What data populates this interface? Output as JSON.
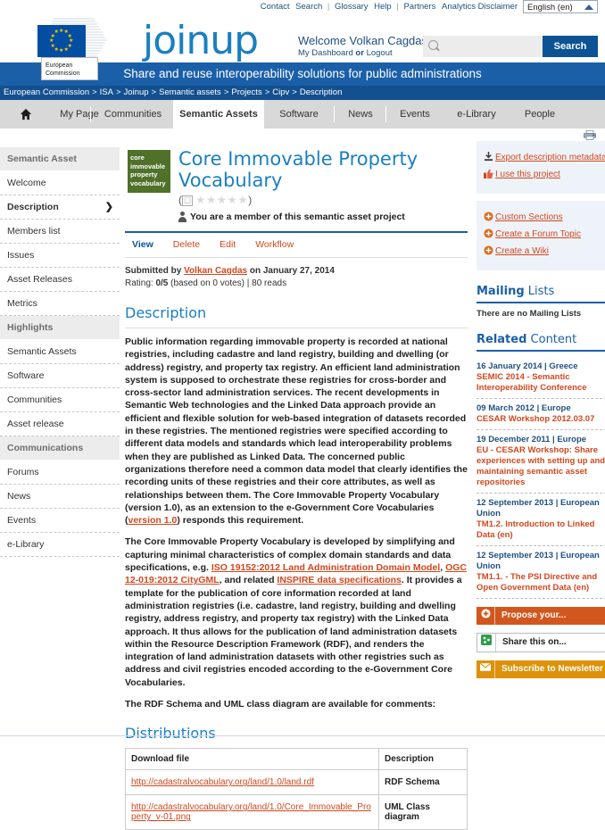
{
  "top_utility": {
    "links": [
      "Contact",
      "Search",
      "Glossary",
      "Help",
      "Partners",
      "Analytics Disclaimer"
    ],
    "language": "English (en)",
    "caret_icon": "caret-up-icon"
  },
  "header": {
    "ec_label": "European Commission",
    "site_logo": "joinup",
    "welcome": "Welcome Volkan Cagdas",
    "my_dashboard": "My Dashboard",
    "or": "or",
    "logout": "Logout",
    "search_placeholder": "",
    "search_value": "",
    "search_button": "Search",
    "search_icon": "search-icon"
  },
  "banner": {
    "ec_tag": "European Commission",
    "tagline": "Share and reuse interoperability solutions for public administrations"
  },
  "breadcrumb": [
    "European Commission",
    "ISA",
    "Joinup",
    "Semantic assets",
    "Projects",
    "Cipv",
    "Description"
  ],
  "nav": {
    "home_icon": "home-icon",
    "tabs": [
      {
        "label": "My Page",
        "active": false
      },
      {
        "label": "Communities",
        "active": false
      },
      {
        "label": "Semantic Assets",
        "active": true
      },
      {
        "label": "Software",
        "active": false
      },
      {
        "label": "News",
        "active": false
      },
      {
        "label": "Events",
        "active": false
      },
      {
        "label": "e-Library",
        "active": false
      },
      {
        "label": "People",
        "active": false
      }
    ]
  },
  "left_sidebar": [
    {
      "type": "head",
      "label": "Semantic Asset"
    },
    {
      "type": "item",
      "label": "Welcome",
      "active": false
    },
    {
      "type": "item",
      "label": "Description",
      "active": true,
      "chevron": "chevron-right-icon"
    },
    {
      "type": "item",
      "label": "Members list",
      "active": false
    },
    {
      "type": "item",
      "label": "Issues",
      "active": false
    },
    {
      "type": "item",
      "label": "Asset Releases",
      "active": false
    },
    {
      "type": "item",
      "label": "Metrics",
      "active": false
    },
    {
      "type": "head",
      "label": "Highlights"
    },
    {
      "type": "item",
      "label": "Semantic Assets",
      "active": false
    },
    {
      "type": "item",
      "label": "Software",
      "active": false
    },
    {
      "type": "item",
      "label": "Communities",
      "active": false
    },
    {
      "type": "item",
      "label": "Asset release",
      "active": false
    },
    {
      "type": "head",
      "label": "Communications"
    },
    {
      "type": "item",
      "label": "Forums",
      "active": false
    },
    {
      "type": "item",
      "label": "News",
      "active": false
    },
    {
      "type": "item",
      "label": "Events",
      "active": false
    },
    {
      "type": "item",
      "label": "e-Library",
      "active": false
    }
  ],
  "asset": {
    "thumb_text": "core immovable property vocabulary",
    "title": "Core Immovable Property Vocabulary",
    "rating_open": "(",
    "rating_close": ")",
    "no_star_icon": "no-rating-icon",
    "stars": "★★★★★",
    "membership_icon": "person-icon",
    "membership": "You are a member of this semantic asset project",
    "op_tabs": [
      {
        "label": "View",
        "active": true
      },
      {
        "label": "Delete",
        "active": false
      },
      {
        "label": "Edit",
        "active": false
      },
      {
        "label": "Workflow",
        "active": false
      }
    ],
    "submitted_prefix": "Submitted by",
    "submitted_author": "Volkan Cagdas",
    "submitted_suffix": "on January 27, 2014",
    "rating_label": "Rating:",
    "rating_value": "0/5",
    "rating_votes": "(based on 0 votes)",
    "reads": "80 reads"
  },
  "description": {
    "heading": "Description",
    "p1": "Public information regarding immovable property is recorded at national registries, including cadastre and land registry, building and dwelling (or address) registry, and property tax registry. An efficient land administration system is supposed to orchestrate these registries for cross-border and cross-sector land administration services. The recent developments in Semantic Web technologies and the Linked Data approach provide an efficient and flexible solution for web-based integration of datasets recorded in these registries. The mentioned registries were specified according to different data models and standards which lead interoperability problems when they are published as Linked Data. The concerned public organizations therefore need a common data model that clearly identifies the recording units of these registries and their core attributes, as well as relationships between them. The ",
    "p1_bold": "Core Immovable Property Vocabulary",
    "p1_cont": " (version 1.0), as an extension to the e-Government Core Vocabularies (",
    "p1_link": "version 1.0",
    "p1_end": ") responds this requirement.",
    "p2_start": "The Core Immovable Property Vocabulary is developed by simplifying and capturing minimal characteristics of complex domain standards and data specifications, e.g. ",
    "p2_link1": "ISO 19152:2012 Land Administration Domain Model",
    "p2_mid1": ", ",
    "p2_link2": "OGC 12-019:2012 CityGML",
    "p2_mid2": ", and related ",
    "p2_link3": "INSPIRE data specifications",
    "p2_end": ". It provides a template for the publication of core information recorded at land administration registries (i.e. cadastre, land registry, building and dwelling registry, address registry, and property tax registry) with the Linked Data approach. It thus allows for the publication of land administration datasets within the Resource Description Framework (RDF), and renders the integration of land administration datasets with other registries such as address and civil registries encoded according to the e-Government Core Vocabularies.",
    "p3": "The RDF Schema and UML class diagram are available for comments:"
  },
  "distributions": {
    "heading": "Distributions",
    "columns": [
      "Download file",
      "Description"
    ],
    "rows": [
      {
        "file": "http://cadastralvocabulary.org/land/1.0/land.rdf",
        "description": "RDF Schema"
      },
      {
        "file": "http://cadastralvocabulary.org/land/1.0/Core_Immovable_Property_v-01.png",
        "description": "UML Class diagram"
      }
    ]
  },
  "right_sidebar": {
    "printer_icon": "printer-icon",
    "box1": [
      {
        "label": "Export description metadata",
        "icon": "download-icon"
      },
      {
        "label": "I use this project",
        "icon": "thumbs-up-icon"
      }
    ],
    "box2": [
      {
        "label": "Custom Sections",
        "icon": "plus-circle-icon"
      },
      {
        "label": "Create a Forum Topic",
        "icon": "plus-circle-icon"
      },
      {
        "label": "Create a Wiki",
        "icon": "plus-circle-icon"
      }
    ],
    "mailing_heading_bold": "Mailing",
    "mailing_heading_rest": " Lists",
    "mailing_empty": "There are no Mailing Lists",
    "related_heading_bold": "Related",
    "related_heading_rest": " Content",
    "related_items": [
      {
        "date": "16 January 2014 | Greece",
        "title": "SEMIC 2014 - Semantic Interoperability Conference"
      },
      {
        "date": "09 March 2012 | Europe",
        "title": "CESAR Workshop 2012.03.07"
      },
      {
        "date": "19 December 2011 | Europe",
        "title": "EU - CESAR Workshop: Share experiences with setting up and maintaining semantic asset repositories"
      },
      {
        "date": "12 September 2013 | European Union",
        "title": "TM1.2. Introduction to Linked Data (en)"
      },
      {
        "date": "12 September 2013 | European Union",
        "title": "TM1.1. - The PSI Directive and Open Government Data (en)"
      }
    ],
    "cta": [
      {
        "label": "Propose your...",
        "icon": "plus-circle-icon",
        "style": "orange"
      },
      {
        "label": "Share this on...",
        "icon": "share-icon",
        "style": "white"
      },
      {
        "label": "Subscribe to Newsletter",
        "icon": "envelope-icon",
        "style": "yellow"
      }
    ]
  },
  "colors": {
    "brand_blue": "#1a7fc1",
    "nav_blue": "#13508f",
    "banner_blue": "#1a5fa8",
    "link_orange": "#d2471e",
    "cta_orange": "#d2571e",
    "cta_yellow": "#dd9209",
    "thumb_green": "#4f7129"
  }
}
